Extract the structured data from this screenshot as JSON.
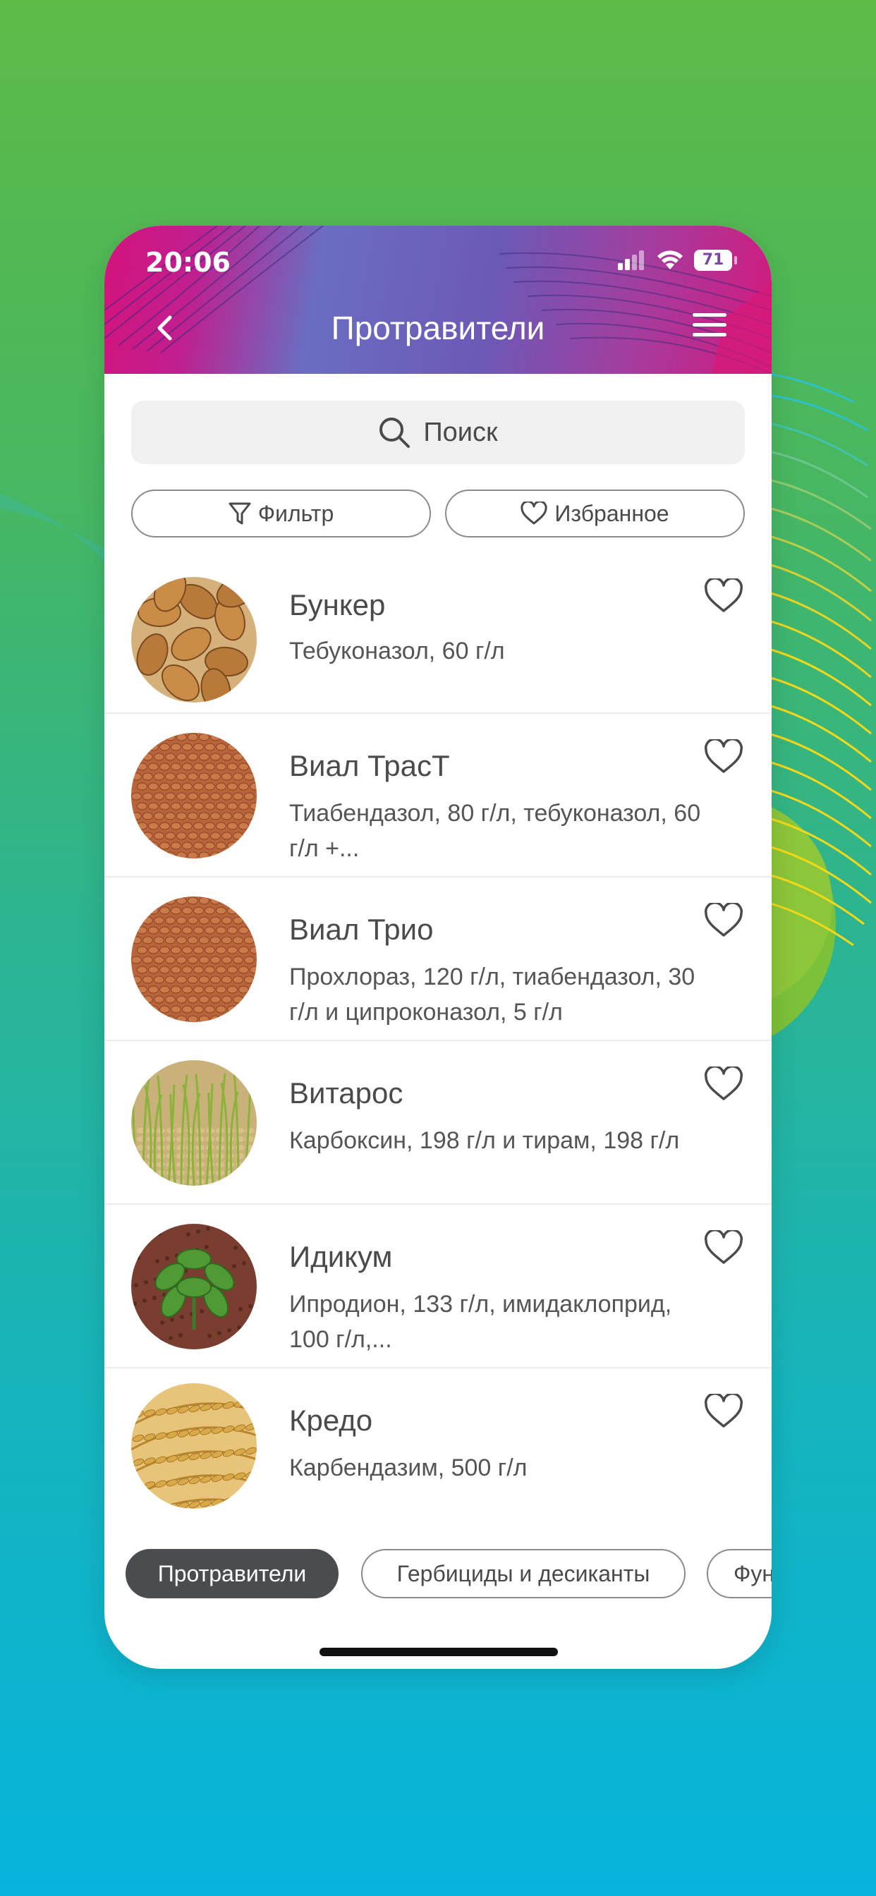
{
  "status": {
    "time": "20:06",
    "battery": "71"
  },
  "header": {
    "title": "Протравители"
  },
  "search": {
    "placeholder": "Поиск"
  },
  "filters": {
    "filter_label": "Фильтр",
    "favorites_label": "Избранное"
  },
  "products": [
    {
      "name": "Бункер",
      "description": "Тебуконазол, 60 г/л",
      "image": "wheat-grains-closeup"
    },
    {
      "name": "Виал ТрасТ",
      "description": "Тиабендазол, 80 г/л, тебуконазол, 60 г/л +...",
      "image": "wheat-grains"
    },
    {
      "name": "Виал Трио",
      "description": "Прохлораз, 120 г/л, тиабендазол, 30 г/л и ципроконазол, 5 г/л",
      "image": "wheat-grains"
    },
    {
      "name": "Витарос",
      "description": "Карбоксин, 198 г/л и тирам, 198 г/л",
      "image": "sprouts"
    },
    {
      "name": "Идикум",
      "description": "Ипродион, 133 г/л, имидаклоприд, 100 г/л,...",
      "image": "potato-plant"
    },
    {
      "name": "Кредо",
      "description": "Карбендазим, 500 г/л",
      "image": "wheat-ears"
    }
  ],
  "categories": [
    {
      "label": "Протравители",
      "active": true
    },
    {
      "label": "Гербициды и десиканты",
      "active": false
    },
    {
      "label": "Фун",
      "active": false
    }
  ],
  "colors": {
    "header_magenta": "#d4137c",
    "header_violet": "#6a6dc2",
    "chip_active": "#4a4c50",
    "bg_top": "#5dba47",
    "bg_bottom": "#06b4dc"
  }
}
